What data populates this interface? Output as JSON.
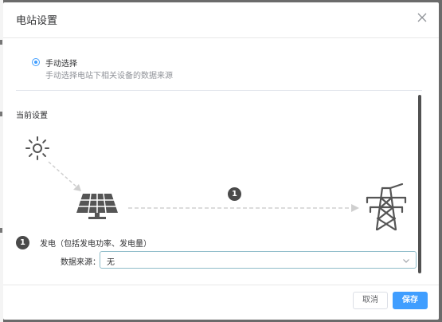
{
  "dialog": {
    "title": "电站设置"
  },
  "mode": {
    "label": "手动选择",
    "description": "手动选择电站下相关设备的数据来源"
  },
  "current": {
    "title": "当前设置",
    "step_badge": "1",
    "info_badge": "1",
    "info_label": "发电（包括发电功率、发电量）",
    "source_label": "数据来源：",
    "source_value": "无"
  },
  "footer": {
    "cancel_label": "取消",
    "save_label": "保存"
  },
  "colors": {
    "accent": "#409eff",
    "icon": "#555555",
    "badge": "#4a4a4a"
  }
}
